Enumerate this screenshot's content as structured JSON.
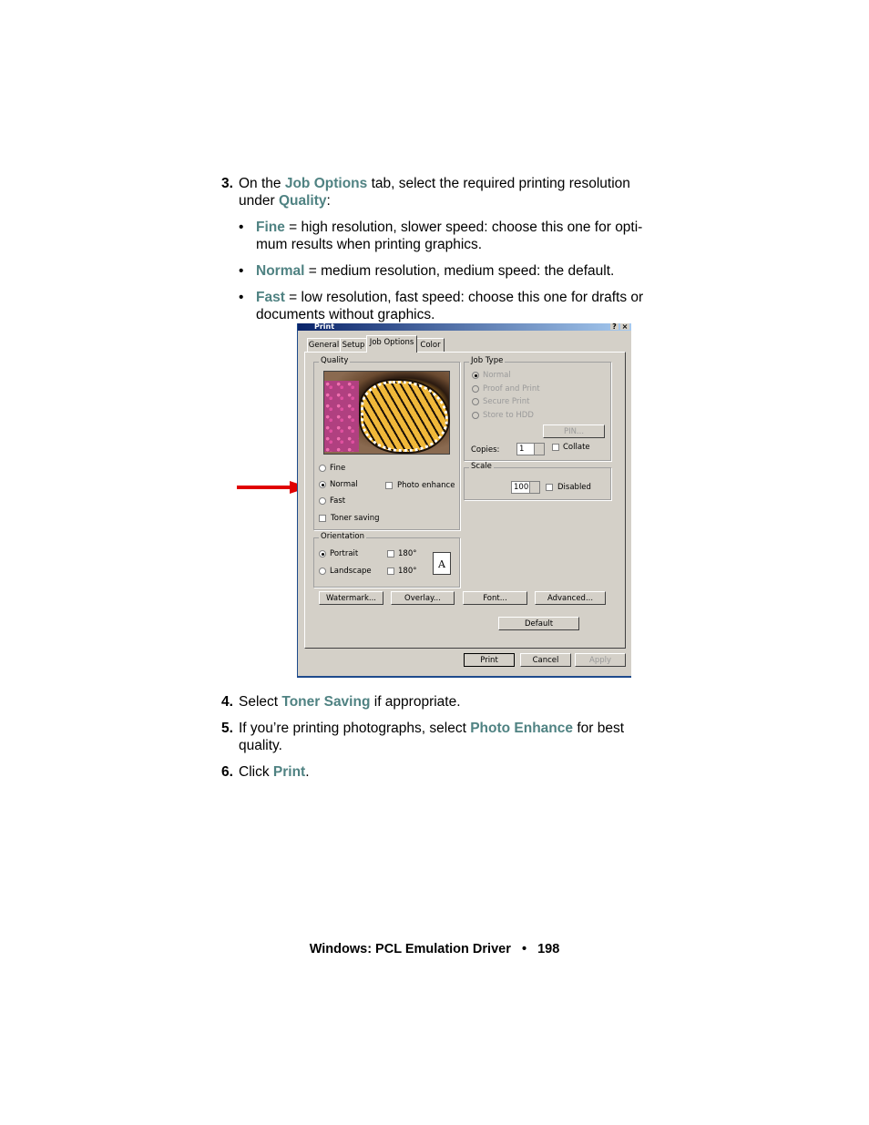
{
  "steps": [
    {
      "num": "3.",
      "pre": "On the ",
      "hl1": "Job Options",
      "mid": " tab, select the required printing resolution under ",
      "hl2": "Quality",
      "post": ":"
    },
    {
      "num": "4.",
      "pre": "Select ",
      "hl1": "Toner Saving",
      "post": " if appropriate."
    },
    {
      "num": "5.",
      "pre": "If you’re printing photographs, select ",
      "hl1": "Photo Enhance",
      "post": " for best quality."
    },
    {
      "num": "6.",
      "pre": "Click ",
      "hl1": "Print",
      "post": "."
    }
  ],
  "bullets": [
    {
      "mark": "•",
      "hl": "Fine",
      "text": " = high resolution, slower speed: choose this one for opti-mum results when printing graphics."
    },
    {
      "mark": "•",
      "hl": "Normal",
      "text": " = medium resolution, medium speed: the default."
    },
    {
      "mark": "•",
      "hl": "Fast",
      "text": " = low resolution, fast speed: choose this one for drafts or documents without graphics."
    }
  ],
  "dialog": {
    "title": "Print",
    "tabs": [
      "General",
      "Setup",
      "Job Options",
      "Color"
    ],
    "active_tab": "Job Options",
    "quality": {
      "label": "Quality",
      "options": [
        "Fine",
        "Normal",
        "Fast"
      ],
      "selected": "Normal",
      "photo_enhance": "Photo enhance",
      "toner_saving": "Toner saving"
    },
    "orientation": {
      "label": "Orientation",
      "portrait": "Portrait",
      "landscape": "Landscape",
      "rotate": "180°",
      "selected": "Portrait",
      "page_icon_letter": "A"
    },
    "job_type": {
      "label": "Job Type",
      "options": [
        "Normal",
        "Proof and Print",
        "Secure Print",
        "Store to HDD"
      ],
      "selected": "Normal",
      "pin": "PIN...",
      "copies_label": "Copies:",
      "copies": "1",
      "collate": "Collate"
    },
    "scale": {
      "label": "Scale",
      "value": "100",
      "disabled": "Disabled"
    },
    "buttons": {
      "watermark": "Watermark...",
      "overlay": "Overlay...",
      "font": "Font...",
      "advanced": "Advanced...",
      "default": "Default",
      "print": "Print",
      "cancel": "Cancel",
      "apply": "Apply"
    },
    "titlebar_buttons": {
      "help": "?",
      "close": "×"
    }
  },
  "colors": {
    "highlight": "#4f8282",
    "arrow": "#e00000",
    "titlebar": "#0a246a"
  },
  "footer": {
    "title": "Windows: PCL Emulation Driver",
    "sep": "•",
    "page": "198"
  }
}
